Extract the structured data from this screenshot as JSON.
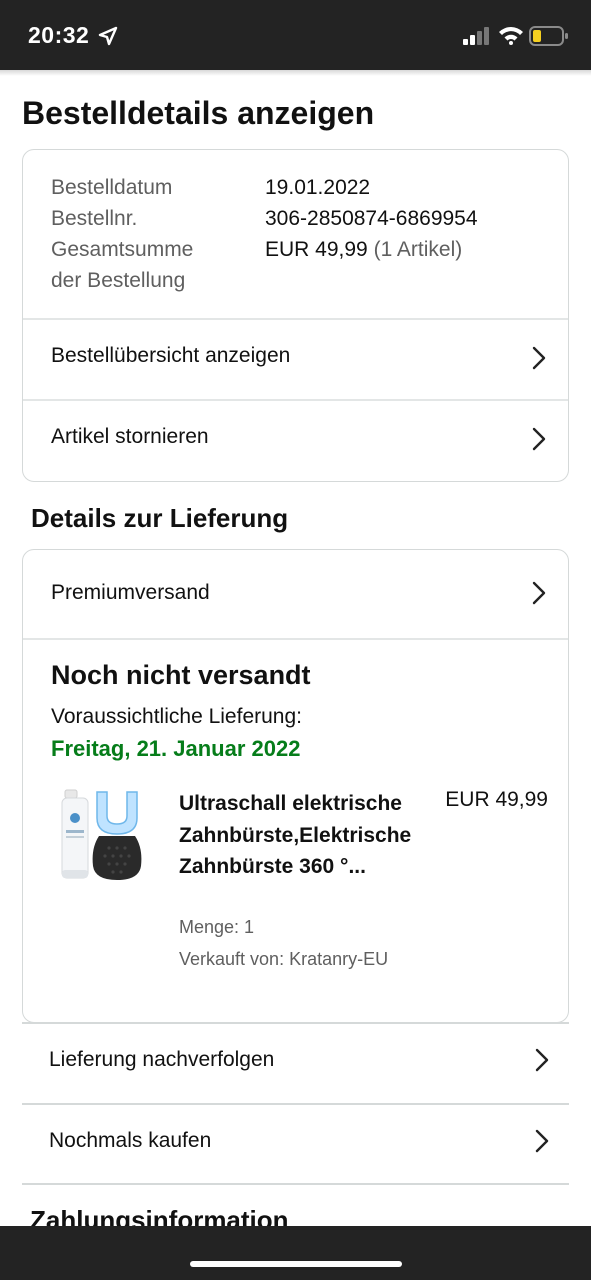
{
  "status_bar": {
    "time": "20:32"
  },
  "page": {
    "title": "Bestelldetails anzeigen"
  },
  "order_summary": {
    "date_label": "Bestelldatum",
    "date_value": "19.01.2022",
    "number_label": "Bestellnr.",
    "number_value": "306-2850874-6869954",
    "total_label_line1": "Gesamtsumme",
    "total_label_line2": "der Bestellung",
    "total_value": "EUR 49,99",
    "total_items": "(1 Artikel)"
  },
  "order_links": {
    "overview": "Bestellübersicht anzeigen",
    "cancel": "Artikel stornieren"
  },
  "delivery": {
    "section_title": "Details zur Lieferung",
    "shipping_method": "Premiumversand",
    "status": "Noch nicht versandt",
    "expected_label": "Voraussichtliche Lieferung:",
    "expected_date": "Freitag, 21. Januar 2022",
    "accent_color": "#067d1a",
    "product": {
      "name": "Ultraschall elektrische Zahnbürste,Elektrische Zahnbürste 360 °...",
      "price": "EUR 49,99",
      "quantity": "Menge: 1",
      "seller": "Verkauft von: Kratanry-EU"
    }
  },
  "actions": {
    "track": "Lieferung nachverfolgen",
    "buy_again": "Nochmals kaufen"
  },
  "payment": {
    "section_title": "Zahlungsinformation"
  }
}
